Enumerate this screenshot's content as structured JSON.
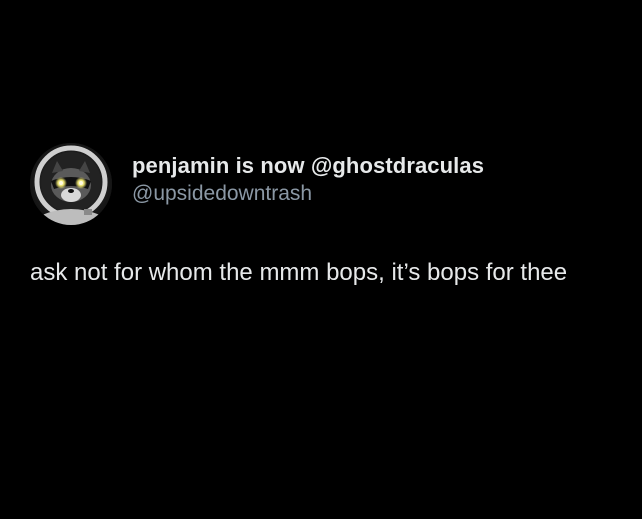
{
  "tweet": {
    "display_name": "penjamin is now @ghostdraculas",
    "handle": "@upsidedowntrash",
    "text": "ask not for whom the mmm bops, it’s bops for thee",
    "avatar_icon": "raccoon-astronaut-avatar"
  },
  "colors": {
    "background": "#000000",
    "primary_text": "#e7e9ea",
    "secondary_text": "#8b98a5"
  }
}
